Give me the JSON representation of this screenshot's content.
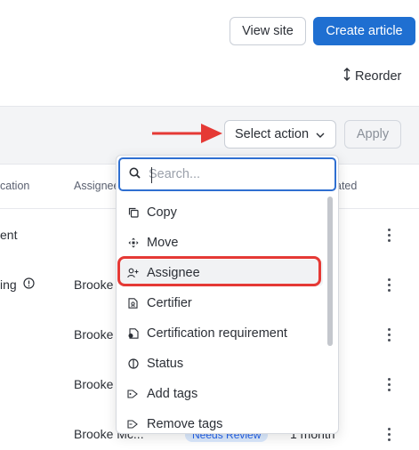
{
  "header": {
    "view_site_label": "View site",
    "create_article_label": "Create article",
    "reorder_label": "Reorder"
  },
  "action_bar": {
    "select_action_label": "Select action",
    "apply_label": "Apply"
  },
  "table": {
    "columns": [
      "cation",
      "Assignee",
      "ated"
    ],
    "rows": [
      {
        "title": "ent",
        "assignee": ""
      },
      {
        "title": "ing",
        "assignee": "Brooke"
      },
      {
        "title": "",
        "assignee": "Brooke"
      },
      {
        "title": "",
        "assignee": "Brooke"
      },
      {
        "title": "",
        "assignee": "Brooke Mc...",
        "badge": "Needs Review",
        "updated": "1 month"
      }
    ]
  },
  "dropdown": {
    "search_placeholder": "Search...",
    "items": [
      {
        "label": "Copy",
        "icon": "copy-icon"
      },
      {
        "label": "Move",
        "icon": "move-icon"
      },
      {
        "label": "Assignee",
        "icon": "assignee-icon"
      },
      {
        "label": "Certifier",
        "icon": "certifier-icon"
      },
      {
        "label": "Certification requirement",
        "icon": "certification-icon"
      },
      {
        "label": "Status",
        "icon": "status-icon"
      },
      {
        "label": "Add tags",
        "icon": "tag-add-icon"
      },
      {
        "label": "Remove tags",
        "icon": "tag-remove-icon"
      }
    ]
  },
  "colors": {
    "primary": "#1f6fd1",
    "annotation_red": "#e53935"
  }
}
